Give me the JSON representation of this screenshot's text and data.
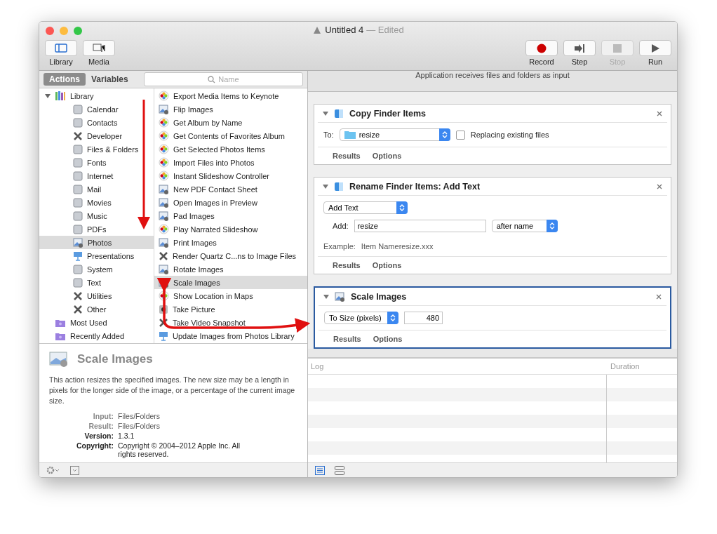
{
  "window": {
    "title": "Untitled 4",
    "status": "— Edited"
  },
  "toolbar_left": [
    {
      "label": "Library",
      "selected": true
    },
    {
      "label": "Media",
      "selected": false
    }
  ],
  "toolbar_right": [
    {
      "label": "Record",
      "kind": "record",
      "disabled": false
    },
    {
      "label": "Step",
      "kind": "step",
      "disabled": false
    },
    {
      "label": "Stop",
      "kind": "stop",
      "disabled": true
    },
    {
      "label": "Run",
      "kind": "run",
      "disabled": false
    }
  ],
  "library_tabs": [
    {
      "label": "Actions",
      "selected": true
    },
    {
      "label": "Variables",
      "selected": false
    }
  ],
  "search": {
    "placeholder": "Name"
  },
  "categories": [
    {
      "label": "Library",
      "kind": "library",
      "selected": false,
      "expanded": true,
      "children": [
        {
          "label": "Calendar",
          "kind": "category",
          "selected": false
        },
        {
          "label": "Contacts",
          "kind": "category",
          "selected": false
        },
        {
          "label": "Developer",
          "kind": "tool",
          "selected": false
        },
        {
          "label": "Files & Folders",
          "kind": "category",
          "selected": false
        },
        {
          "label": "Fonts",
          "kind": "category",
          "selected": false
        },
        {
          "label": "Internet",
          "kind": "category",
          "selected": false
        },
        {
          "label": "Mail",
          "kind": "category",
          "selected": false
        },
        {
          "label": "Movies",
          "kind": "category",
          "selected": false
        },
        {
          "label": "Music",
          "kind": "category",
          "selected": false
        },
        {
          "label": "PDFs",
          "kind": "category",
          "selected": false
        },
        {
          "label": "Photos",
          "kind": "image",
          "selected": true
        },
        {
          "label": "Presentations",
          "kind": "presentation",
          "selected": false
        },
        {
          "label": "System",
          "kind": "category",
          "selected": false
        },
        {
          "label": "Text",
          "kind": "category",
          "selected": false
        },
        {
          "label": "Utilities",
          "kind": "tool",
          "selected": false
        },
        {
          "label": "Other",
          "kind": "tool",
          "selected": false
        }
      ]
    },
    {
      "label": "Most Used",
      "kind": "smart",
      "selected": false
    },
    {
      "label": "Recently Added",
      "kind": "smart",
      "selected": false
    }
  ],
  "actions": [
    {
      "label": "Export Media Items to Keynote",
      "kind": "photos",
      "selected": false
    },
    {
      "label": "Flip Images",
      "kind": "image",
      "selected": false
    },
    {
      "label": "Get Album by Name",
      "kind": "photos",
      "selected": false
    },
    {
      "label": "Get Contents of Favorites Album",
      "kind": "photos",
      "selected": false
    },
    {
      "label": "Get Selected Photos Items",
      "kind": "photos",
      "selected": false
    },
    {
      "label": "Import Files into Photos",
      "kind": "photos",
      "selected": false
    },
    {
      "label": "Instant Slideshow Controller",
      "kind": "photos",
      "selected": false
    },
    {
      "label": "New PDF Contact Sheet",
      "kind": "image",
      "selected": false
    },
    {
      "label": "Open Images in Preview",
      "kind": "image",
      "selected": false
    },
    {
      "label": "Pad Images",
      "kind": "image",
      "selected": false
    },
    {
      "label": "Play Narrated Slideshow",
      "kind": "photos",
      "selected": false
    },
    {
      "label": "Print Images",
      "kind": "image",
      "selected": false
    },
    {
      "label": "Render Quartz C...ns to Image Files",
      "kind": "tool",
      "selected": false
    },
    {
      "label": "Rotate Images",
      "kind": "image",
      "selected": false
    },
    {
      "label": "Scale Images",
      "kind": "image",
      "selected": true
    },
    {
      "label": "Show Location in Maps",
      "kind": "photos",
      "selected": false
    },
    {
      "label": "Take Picture",
      "kind": "camera",
      "selected": false
    },
    {
      "label": "Take Video Snapshot",
      "kind": "tool",
      "selected": false
    },
    {
      "label": "Update Images from Photos Library",
      "kind": "presentation",
      "selected": false
    }
  ],
  "description": {
    "title": "Scale Images",
    "text": "This action resizes the specified images. The new size may be a length in pixels for the longer side of the image, or a percentage of the current image size.",
    "fields": [
      {
        "label": "Input:",
        "value": "Files/Folders"
      },
      {
        "label": "Result:",
        "value": "Files/Folders"
      },
      {
        "label": "Version:",
        "value": "1.3.1"
      },
      {
        "label": "Copyright:",
        "value": "Copyright © 2004–2012 Apple Inc.  All rights reserved."
      }
    ]
  },
  "workflow": {
    "input_note": "Application receives files and folders as input",
    "cards": [
      {
        "kind": "copy",
        "title": "Copy Finder Items",
        "selected": false,
        "to_label": "To:",
        "folder": "resize",
        "checkbox": {
          "label": "Replacing existing files",
          "checked": false
        },
        "footer": [
          "Results",
          "Options"
        ]
      },
      {
        "kind": "rename",
        "title": "Rename Finder Items: Add Text",
        "selected": false,
        "mode": "Add Text",
        "add_label": "Add:",
        "add_value": "resize",
        "position": "after name",
        "example_label": "Example:",
        "example": "Item Nameresize.xxx",
        "footer": [
          "Results",
          "Options"
        ]
      },
      {
        "kind": "scale",
        "title": "Scale Images",
        "selected": true,
        "mode": "To Size (pixels)",
        "size": "480",
        "footer": [
          "Results",
          "Options"
        ]
      }
    ]
  },
  "log": {
    "columns": [
      "Log",
      "Duration"
    ]
  }
}
